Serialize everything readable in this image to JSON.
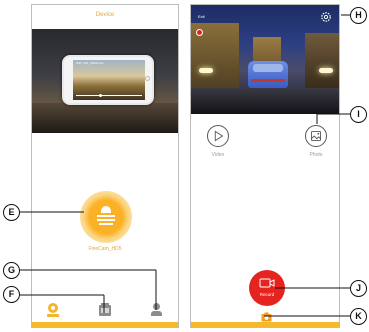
{
  "colors": {
    "accent": "#f4b42d",
    "label_gray": "#9a9a9a",
    "header_text": "#e8a637",
    "record_red": "#e52420",
    "bottom_strip": "#f6b82c",
    "camera_icon": "#f39c1a"
  },
  "left_phone": {
    "header_title": "Device",
    "hero_caption": "2018_0101_104833.mov",
    "device_label": "FineCam_HD5",
    "icons": {
      "device_tab": "device-icon",
      "album_tab": "album-icon",
      "profile_tab": "profile-icon"
    }
  },
  "right_phone": {
    "top_left_label": "Exit",
    "settings_icon": "gear-icon",
    "modes": [
      {
        "label": "Video",
        "icon": "play-icon"
      },
      {
        "label": "Photo",
        "icon": "image-icon"
      }
    ],
    "record_label": "Record",
    "record_icon": "video-camera-icon",
    "camera_switch_icon": "camera-icon"
  },
  "callouts": {
    "E": "E",
    "F": "F",
    "G": "G",
    "H": "H",
    "I": "I",
    "J": "J",
    "K": "K"
  }
}
